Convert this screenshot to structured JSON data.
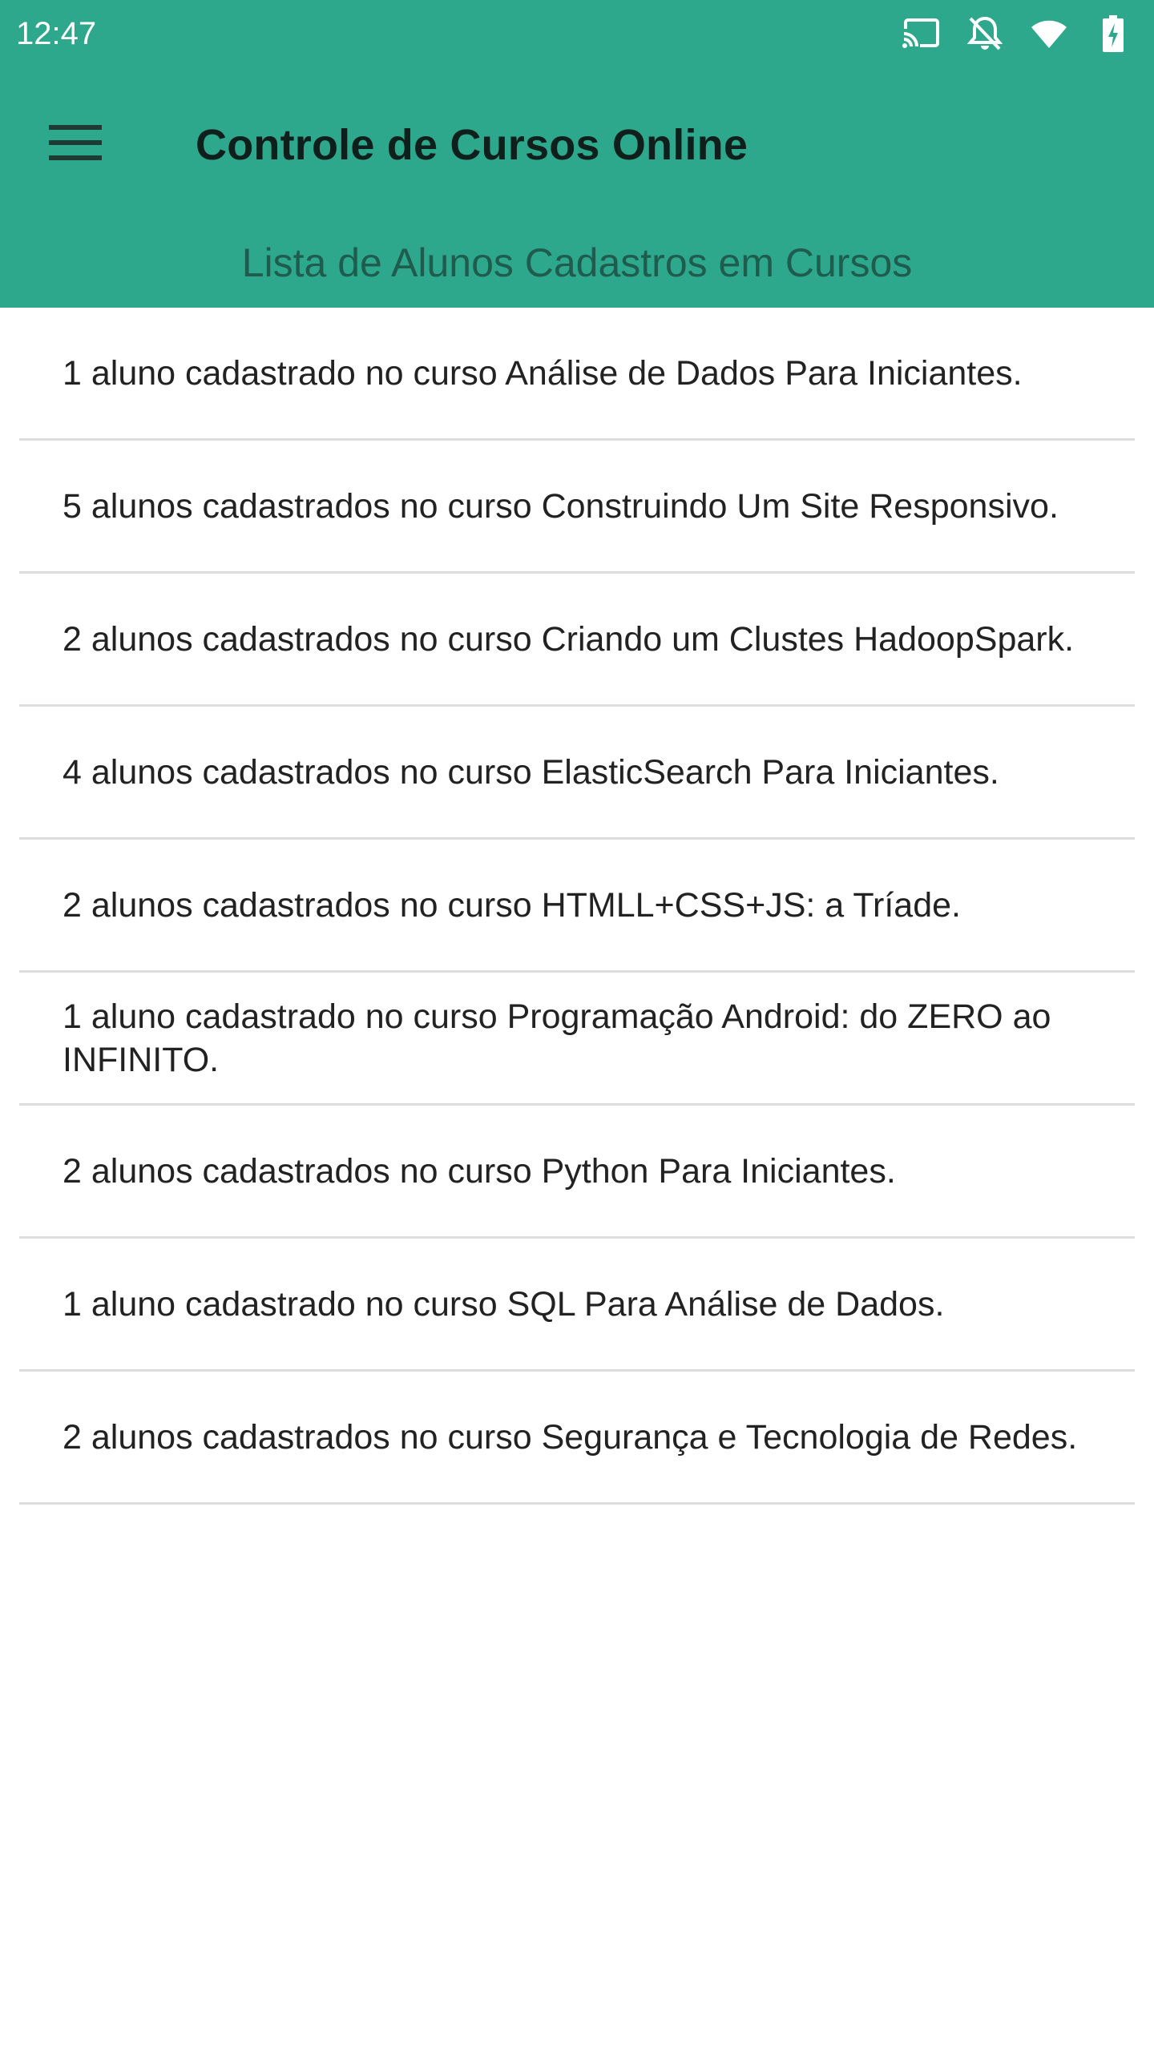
{
  "status_bar": {
    "time": "12:47",
    "icons": [
      "cast-icon",
      "notifications-off-icon",
      "wifi-icon",
      "battery-charging-icon"
    ]
  },
  "toolbar": {
    "menu_icon": "menu-icon",
    "title": "Controle de Cursos Online"
  },
  "header": {
    "subtitle": "Lista de Alunos Cadastros em Cursos"
  },
  "colors": {
    "header_bg": "#2ea88c",
    "title_text": "#0f1f1b",
    "subtitle_text": "#1f5c4e",
    "divider": "#dddddd"
  },
  "courses": [
    {
      "text": "1 aluno cadastrado no curso Análise de Dados Para Iniciantes."
    },
    {
      "text": "5 alunos cadastrados no curso Construindo Um Site Responsivo."
    },
    {
      "text": "2 alunos cadastrados no curso Criando um Clustes HadoopSpark."
    },
    {
      "text": "4 alunos cadastrados no curso ElasticSearch Para Iniciantes."
    },
    {
      "text": "2 alunos cadastrados no curso HTMLL+CSS+JS: a Tríade."
    },
    {
      "text": "1 aluno cadastrado no curso Programação Android: do ZERO ao INFINITO."
    },
    {
      "text": "2 alunos cadastrados no curso Python Para Iniciantes."
    },
    {
      "text": "1 aluno cadastrado no curso SQL Para Análise de Dados."
    },
    {
      "text": "2 alunos cadastrados no curso Segurança e Tecnologia de Redes."
    }
  ]
}
